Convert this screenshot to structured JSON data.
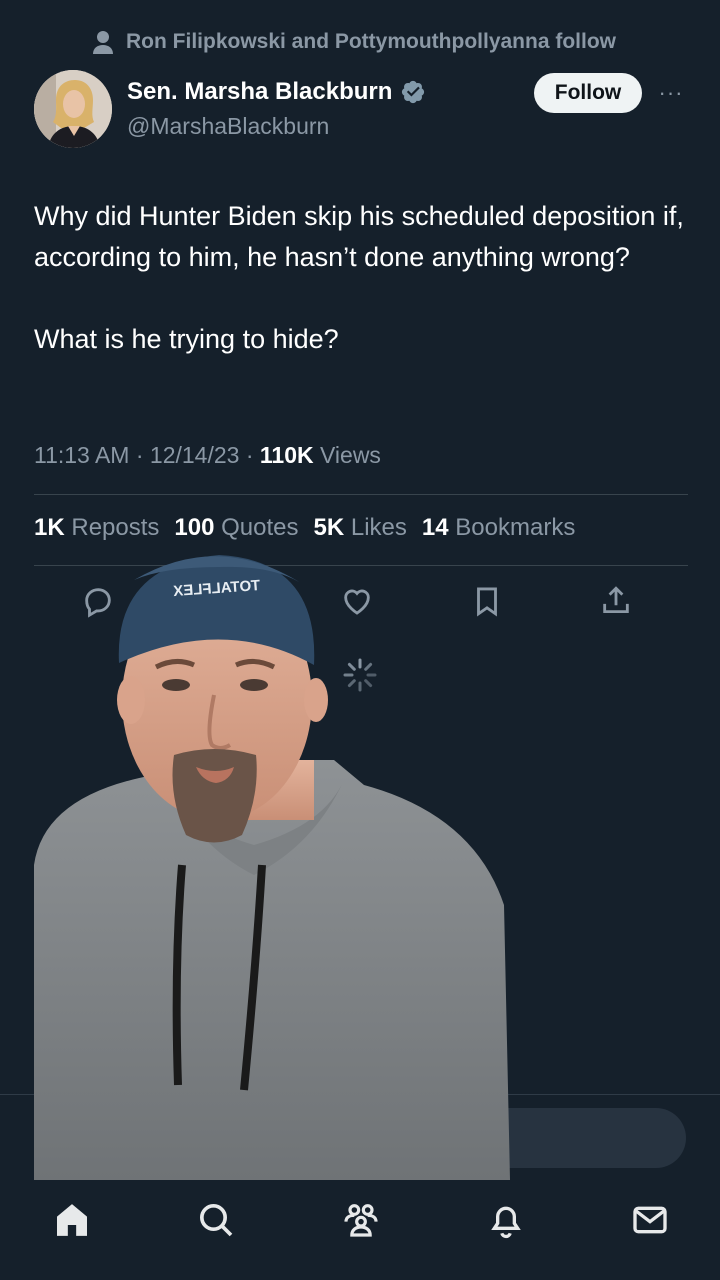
{
  "social_context": "Ron Filipkowski and Pottymouthpollyanna follow",
  "author": {
    "name": "Sen. Marsha Blackburn",
    "handle": "@MarshaBlackburn",
    "verified": true
  },
  "follow_label": "Follow",
  "more_label": "···",
  "tweet": {
    "paragraphs": [
      "Why did Hunter Biden skip his scheduled deposition if, according to him, he hasn’t done anything wrong?",
      "What is he trying to hide?"
    ],
    "time": "11:13 AM · 12/14/23 · ",
    "views_count": "110K",
    "views_label": " Views"
  },
  "stats": [
    {
      "count": "1K",
      "label": "Reposts"
    },
    {
      "count": "100",
      "label": "Quotes"
    },
    {
      "count": "5K",
      "label": "Likes"
    },
    {
      "count": "14",
      "label": "Bookmarks"
    }
  ],
  "cap_text": "TOTALFLEX",
  "actions": [
    "reply-icon",
    "repost-icon",
    "like-icon",
    "bookmark-icon",
    "share-icon"
  ],
  "nav": [
    "home-icon",
    "search-icon",
    "communities-icon",
    "notifications-icon",
    "messages-icon"
  ],
  "colors": {
    "background": "#15202b",
    "text": "#e7e9ea",
    "secondary": "#8b98a5",
    "verified": "#829aab",
    "follow_bg": "#eff3f4"
  }
}
